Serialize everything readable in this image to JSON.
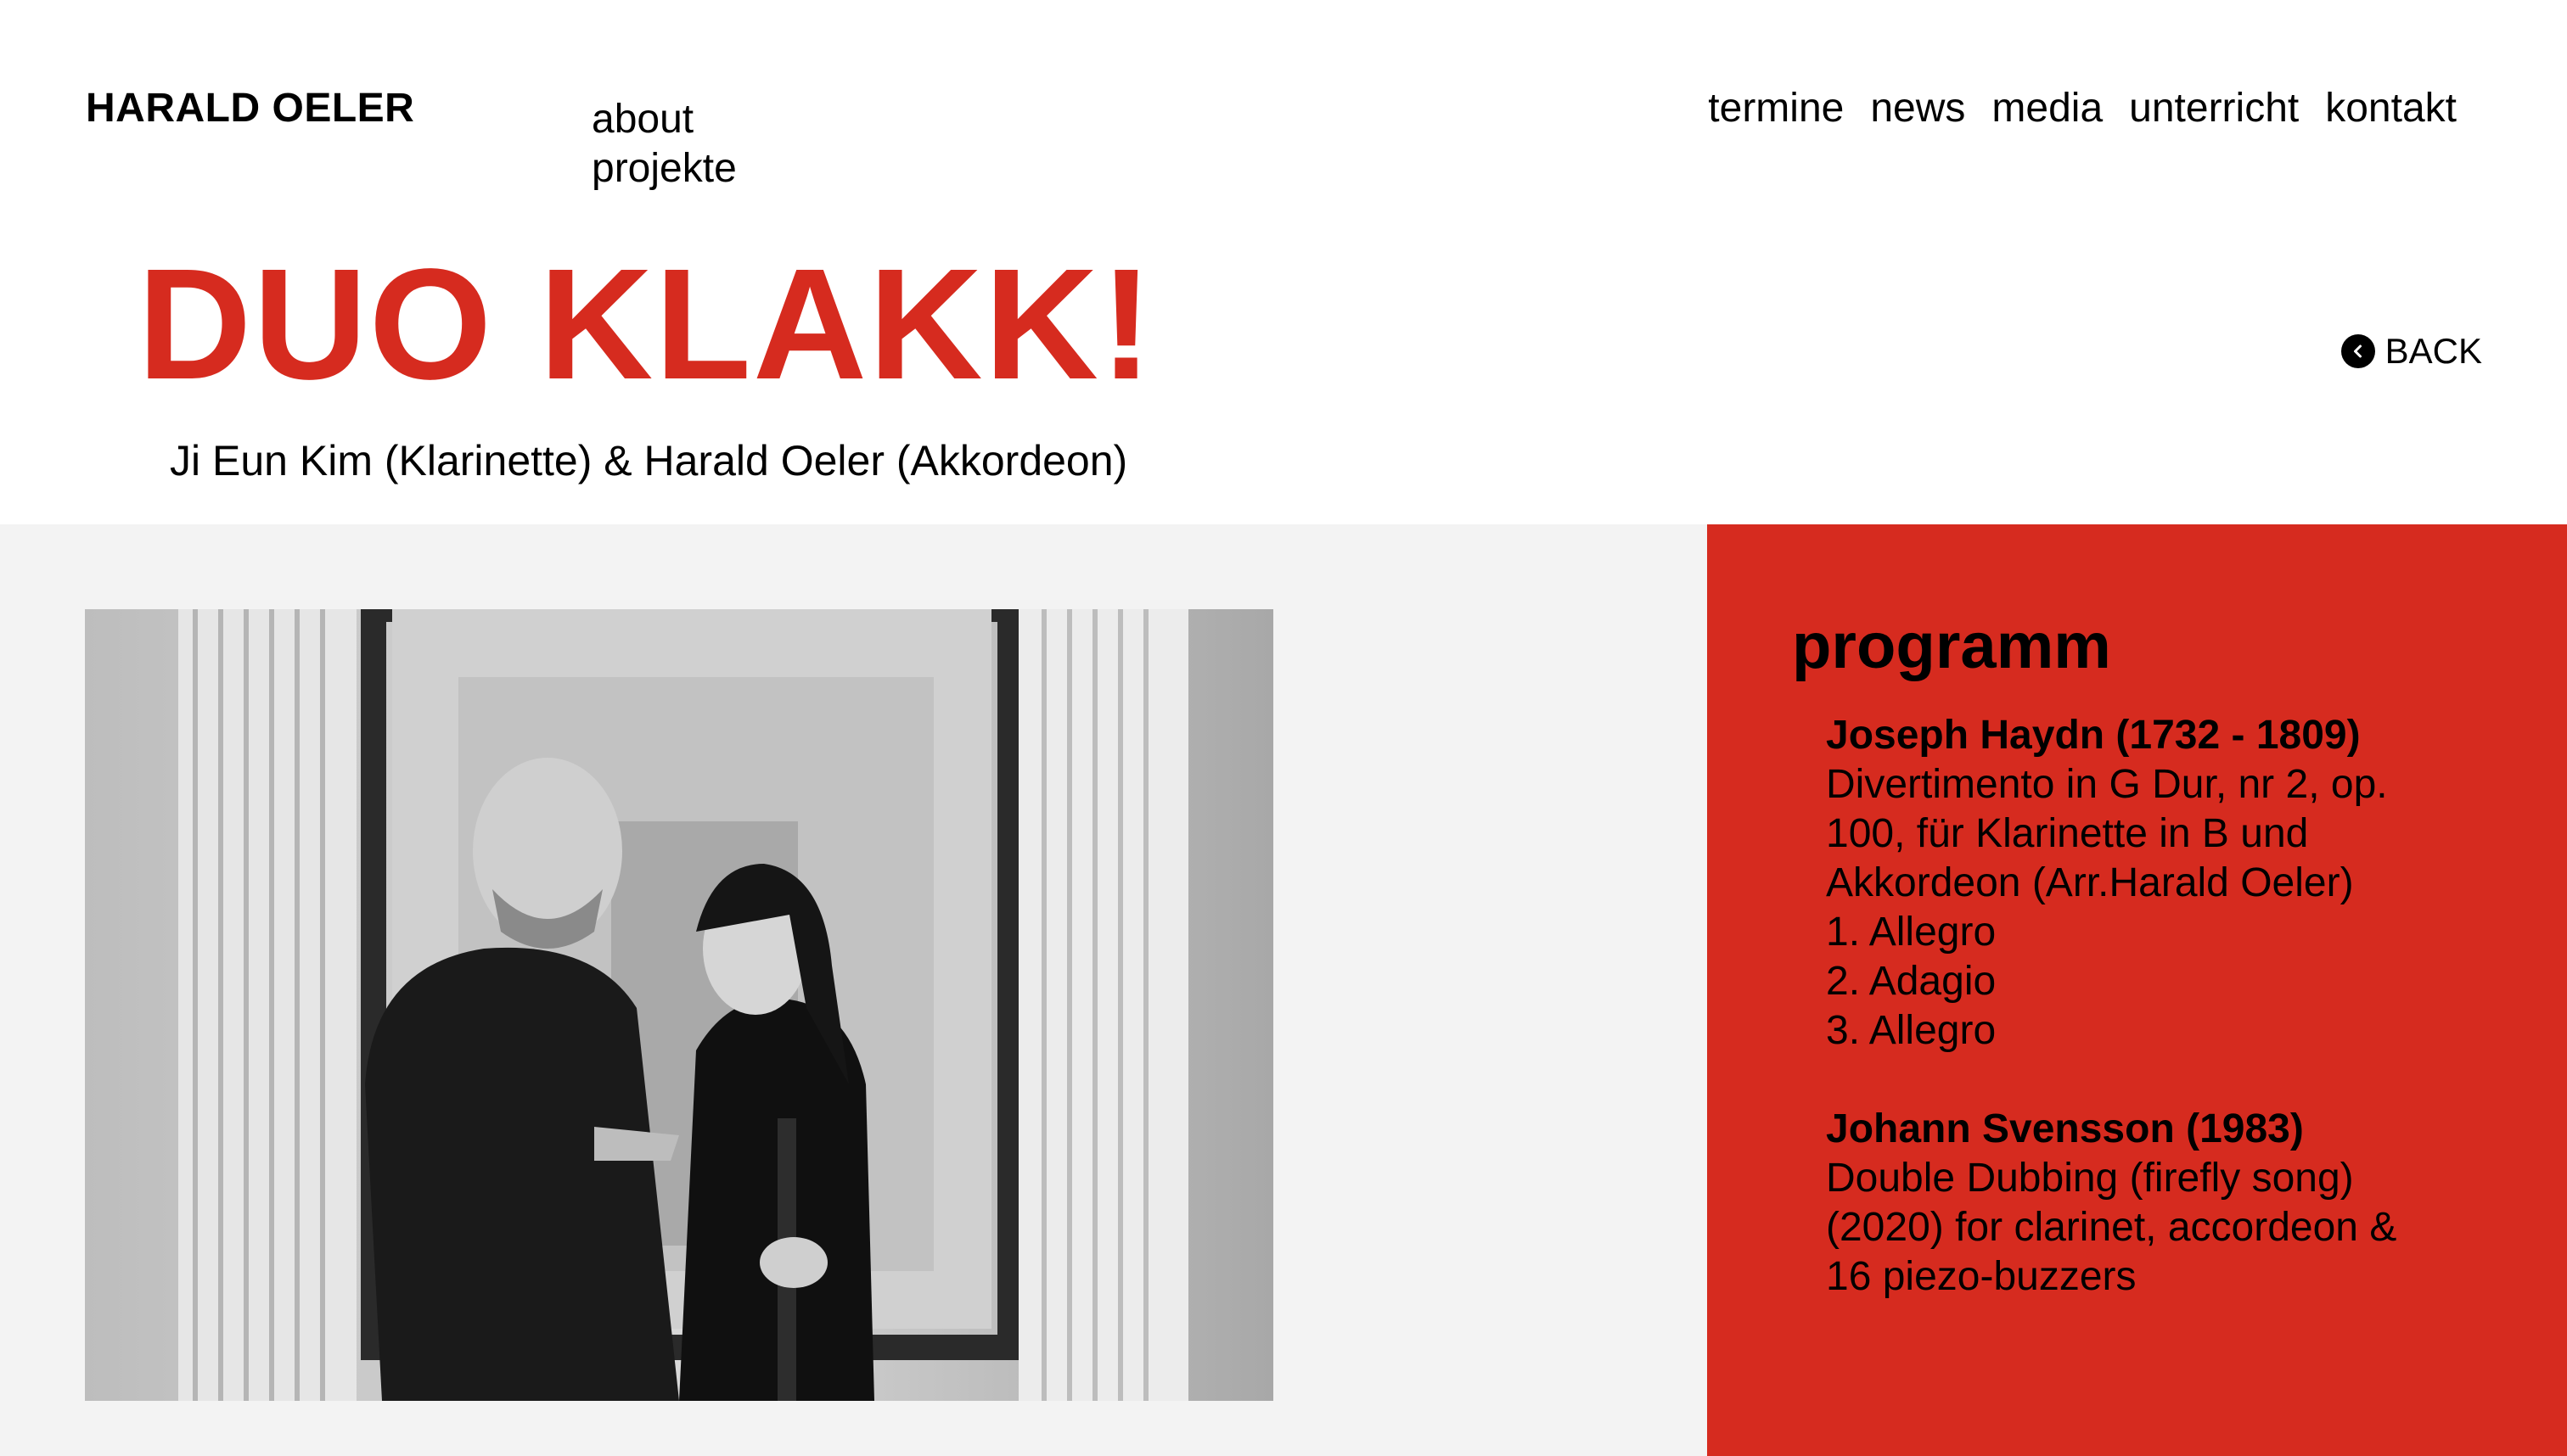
{
  "header": {
    "site_name": "HARALD OELER",
    "left_nav": [
      "about",
      "projekte"
    ],
    "top_nav": [
      "termine",
      "news",
      "media",
      "unterricht",
      "kontakt"
    ]
  },
  "project": {
    "title": "DUO KLAKK!",
    "subtitle": "Ji Eun Kim (Klarinette) & Harald Oeler (Akkordeon)",
    "back_label": "BACK"
  },
  "program": {
    "heading": "programm",
    "pieces": [
      {
        "composer": "Joseph Haydn (1732 - 1809)",
        "lines": [
          "Divertimento in G Dur, nr 2, op.",
          "100, für Klarinette in B und",
          "Akkordeon (Arr.Harald Oeler)",
          "1. Allegro",
          "2. Adagio",
          "3. Allegro"
        ]
      },
      {
        "composer": "Johann Svensson (1983)",
        "lines": [
          "Double Dubbing (firefly song)",
          "(2020) for clarinet, accordeon &",
          "16 piezo-buzzers"
        ]
      }
    ]
  },
  "colors": {
    "accent": "#d62b1f",
    "panel_gray": "#f3f3f3"
  }
}
